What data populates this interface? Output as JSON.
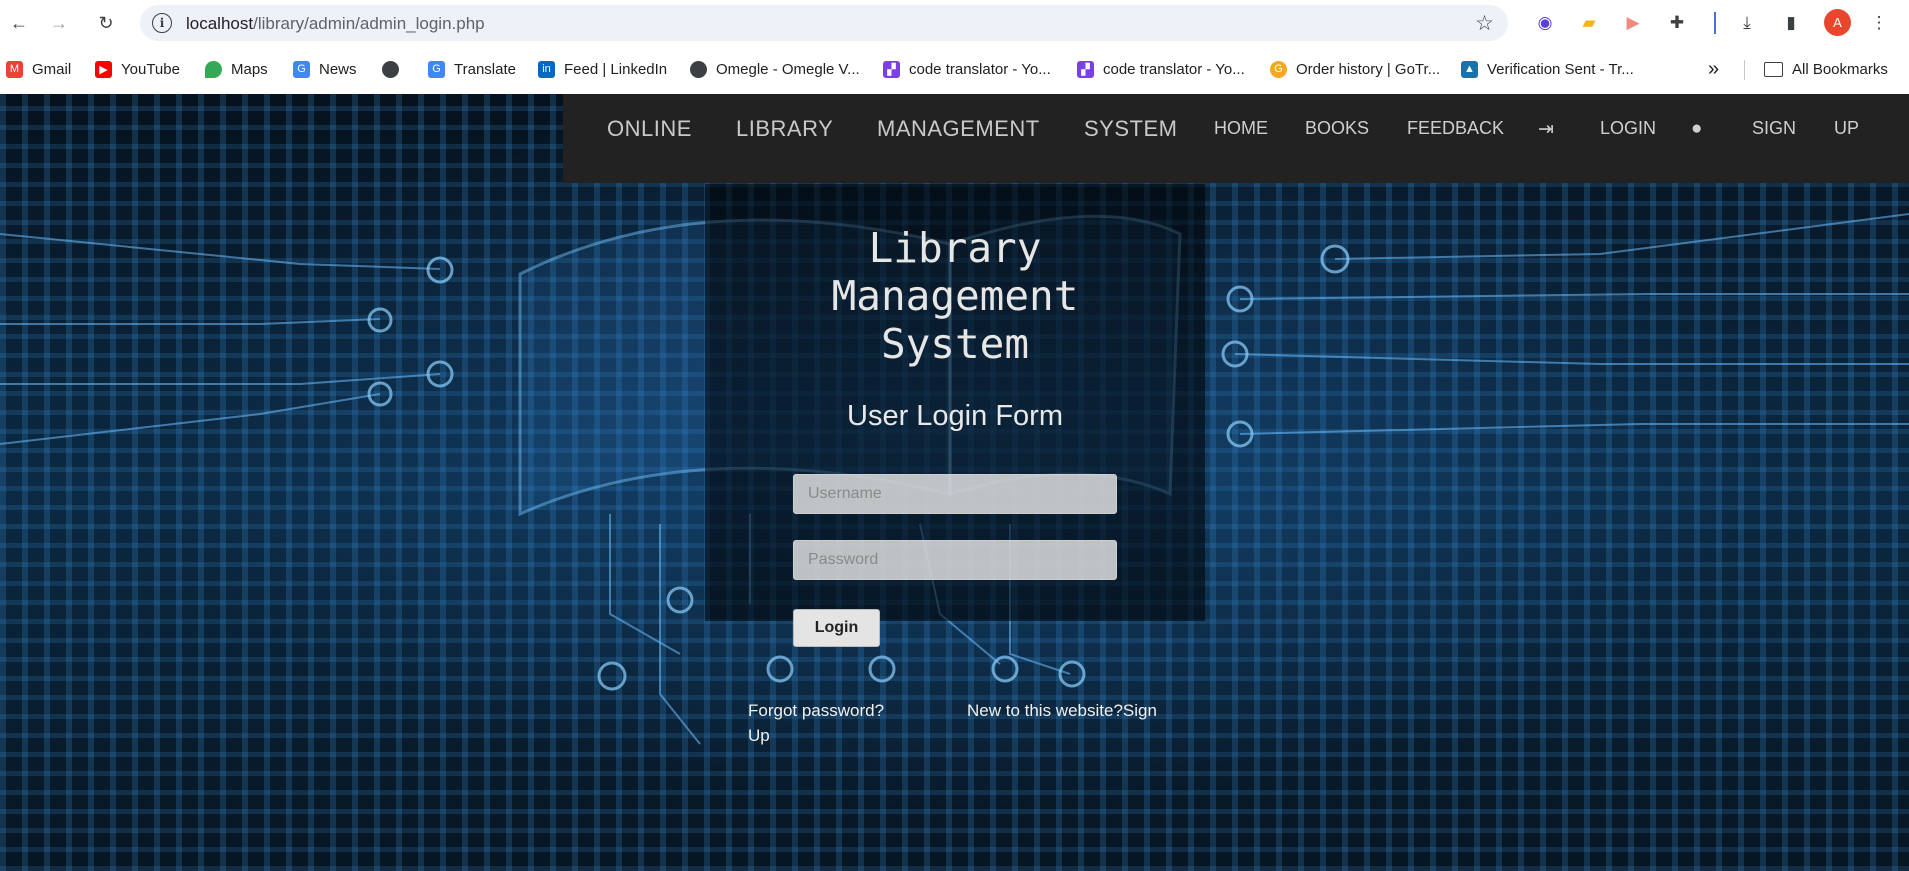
{
  "browser": {
    "url_host": "localhost",
    "url_path": "/library/admin/admin_login.php",
    "avatar_letter": "A",
    "bookmarks": [
      {
        "label": "Gmail",
        "icon": "gmail-icon",
        "color": "#ea4335"
      },
      {
        "label": "YouTube",
        "icon": "youtube-icon",
        "color": "#ff0000"
      },
      {
        "label": "Maps",
        "icon": "maps-icon",
        "color": "#34a853"
      },
      {
        "label": "News",
        "icon": "news-icon",
        "color": "#4285f4"
      },
      {
        "label": "",
        "icon": "globe-icon",
        "color": "#3c4043"
      },
      {
        "label": "Translate",
        "icon": "translate-icon",
        "color": "#4285f4"
      },
      {
        "label": "Feed | LinkedIn",
        "icon": "linkedin-icon",
        "color": "#0a66c2"
      },
      {
        "label": "Omegle - Omegle V...",
        "icon": "globe-icon",
        "color": "#3c4043"
      },
      {
        "label": "code translator - Yo...",
        "icon": "code-translator-icon",
        "color": "#7b3fe4"
      },
      {
        "label": "code translator - Yo...",
        "icon": "code-translator-icon",
        "color": "#7b3fe4"
      },
      {
        "label": "Order history | GoTr...",
        "icon": "gotranscript-icon",
        "color": "#f5a623"
      },
      {
        "label": "Verification Sent - Tr...",
        "icon": "verification-icon",
        "color": "#1a73a8"
      }
    ],
    "more_bookmarks": "»",
    "all_bookmarks": "All Bookmarks"
  },
  "site_nav": {
    "brand_words": [
      "ONLINE",
      "LIBRARY",
      "MANAGEMENT",
      "SYSTEM"
    ],
    "links": {
      "home": "HOME",
      "books": "BOOKS",
      "feedback": "FEEDBACK",
      "login": "LOGIN",
      "sign": "SIGN",
      "up": "UP"
    }
  },
  "login": {
    "title_lines": [
      "Library",
      "Management",
      "System"
    ],
    "form_title": "User Login Form",
    "username_placeholder": "Username",
    "password_placeholder": "Password",
    "submit_label": "Login",
    "forgot_line1": "Forgot password?",
    "forgot_line2": "Up",
    "signup_text": "New to this website?Sign"
  }
}
